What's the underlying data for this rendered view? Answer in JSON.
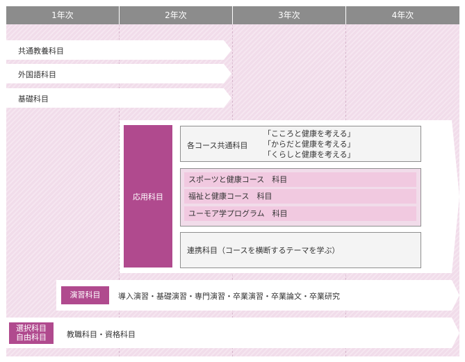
{
  "years": [
    "1年次",
    "2年次",
    "3年次",
    "4年次"
  ],
  "general_rows": [
    {
      "label": "共通教養科目"
    },
    {
      "label": "外国語科目"
    },
    {
      "label": "基礎科目"
    }
  ],
  "applied": {
    "tag": "応用科目",
    "common": {
      "label": "各コース共通科目",
      "items": [
        "「こころと健康を考える」",
        "「からだと健康を考える」",
        "「くらしと健康を考える」"
      ]
    },
    "courses": [
      "スポーツと健康コース　科目",
      "福祉と健康コース　科目",
      "ユーモア学プログラム　科目"
    ],
    "cooperation": "連携科目（コースを横断するテーマを学ぶ）"
  },
  "seminar": {
    "tag": "演習科目",
    "text": "導入演習・基礎演習・専門演習・卒業演習・卒業論文・卒業研究"
  },
  "elective": {
    "tag_line1": "選択科目",
    "tag_line2": "自由科目",
    "text": "教職科目・資格科目"
  },
  "colors": {
    "header": "#8c8c8c",
    "column": "#f1dcea",
    "accent": "#b04a8e",
    "course_band": "#f1c9e0"
  }
}
